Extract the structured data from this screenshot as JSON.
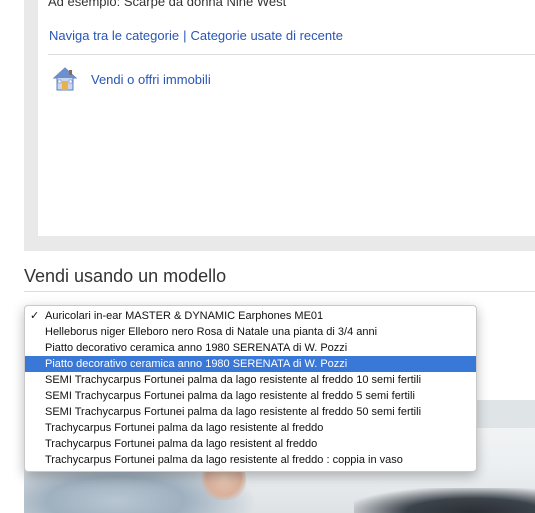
{
  "search": {
    "example_text": "Ad esempio: Scarpe da donna Nine West",
    "browse_categories_link": "Naviga tra le categorie",
    "separator": "|",
    "recent_categories_link": "Categorie usate di recente"
  },
  "real_estate": {
    "icon": "house-icon",
    "label": "Vendi o offri immobili"
  },
  "template_section": {
    "title": "Vendi usando un modello",
    "checkmark": "✓",
    "options": [
      {
        "label": "Auricolari in-ear MASTER & DYNAMIC Earphones ME01",
        "checked": true,
        "highlighted": false
      },
      {
        "label": "Helleborus niger Elleboro nero Rosa di Natale una pianta di 3/4 anni",
        "checked": false,
        "highlighted": false
      },
      {
        "label": "Piatto decorativo ceramica anno 1980 SERENATA di W. Pozzi",
        "checked": false,
        "highlighted": false
      },
      {
        "label": "Piatto decorativo ceramica anno 1980 SERENATA di W. Pozzi",
        "checked": false,
        "highlighted": true
      },
      {
        "label": "SEMI Trachycarpus Fortunei palma da lago resistente al freddo 10 semi fertili",
        "checked": false,
        "highlighted": false
      },
      {
        "label": "SEMI Trachycarpus Fortunei palma da lago resistente al freddo 5 semi fertili",
        "checked": false,
        "highlighted": false
      },
      {
        "label": "SEMI Trachycarpus Fortunei palma da lago resistente al freddo 50 semi fertili",
        "checked": false,
        "highlighted": false
      },
      {
        "label": "Trachycarpus Fortunei palma da lago resistente al freddo",
        "checked": false,
        "highlighted": false
      },
      {
        "label": "Trachycarpus Fortunei palma da lago resistent al freddo",
        "checked": false,
        "highlighted": false
      },
      {
        "label": "Trachycarpus Fortunei palma da lago resistente al freddo : coppia in vaso",
        "checked": false,
        "highlighted": false
      }
    ]
  },
  "colors": {
    "link": "#2a55b5",
    "highlight": "#3a78d8",
    "panel_gray": "#e9e9e9"
  }
}
